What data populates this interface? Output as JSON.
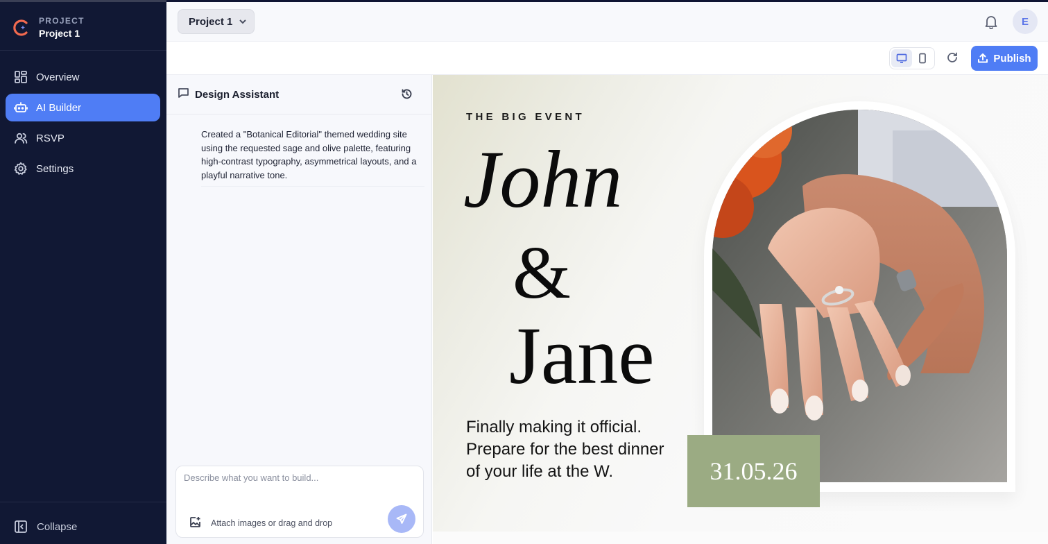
{
  "sidebar": {
    "kicker": "PROJECT",
    "project_name": "Project 1",
    "items": [
      {
        "label": "Overview",
        "icon": "grid-icon"
      },
      {
        "label": "AI Builder",
        "icon": "robot-icon",
        "active": true
      },
      {
        "label": "RSVP",
        "icon": "users-icon"
      },
      {
        "label": "Settings",
        "icon": "gear-icon"
      }
    ],
    "collapse_label": "Collapse"
  },
  "header": {
    "project_select": "Project 1",
    "avatar_initial": "E"
  },
  "toolbar": {
    "publish_label": "Publish",
    "device_active": "desktop"
  },
  "chat": {
    "title": "Design Assistant",
    "message": "Created a \"Botanical Editorial\" themed wedding site using the requested sage and olive palette, featuring high-contrast typography, asymmetrical layouts, and a playful narrative tone.",
    "input_placeholder": "Describe what you want to build...",
    "attach_label": "Attach images or drag and drop"
  },
  "preview": {
    "eyebrow": "THE BIG EVENT",
    "name_1": "John",
    "ampersand": "&",
    "name_2": "Jane",
    "tagline": "Finally making it official. Prepare for the best dinner of your life at the W.",
    "date": "31.05.26",
    "accent_color": "#9bab83"
  },
  "colors": {
    "sidebar_bg": "#111834",
    "primary": "#4f7df5",
    "send_disabled": "#a8b8f7"
  }
}
